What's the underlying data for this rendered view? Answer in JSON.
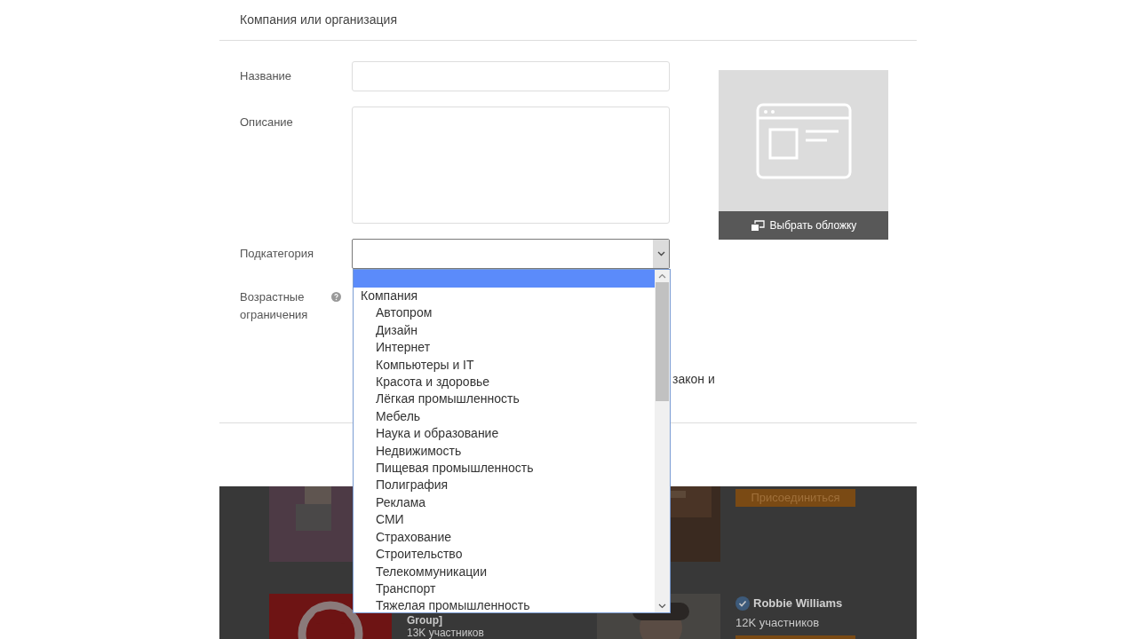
{
  "header": {
    "title": "Компания или организация"
  },
  "form": {
    "fields": [
      {
        "kind": "input",
        "label": "Название"
      },
      {
        "kind": "textarea",
        "label": "Описание"
      },
      {
        "kind": "select",
        "label": "Подкатегория",
        "expanded": true
      },
      {
        "kind": "info",
        "label": "Возрастные ограничения"
      }
    ],
    "partial_text": "закон и"
  },
  "cover": {
    "button": "Выбрать обложку"
  },
  "dropdown": {
    "empty_option_selected": true,
    "groups": [
      {
        "label": "Компания",
        "options": [
          {
            "label": "Автопром",
            "selected": false
          },
          {
            "label": "Дизайн",
            "selected": false
          },
          {
            "label": "Интернет",
            "selected": false
          },
          {
            "label": "Компьютеры и IT",
            "selected": false
          },
          {
            "label": "Красота и здоровье",
            "selected": false
          },
          {
            "label": "Лёгкая промышленность",
            "selected": false
          },
          {
            "label": "Мебель",
            "selected": false
          },
          {
            "label": "Наука и образование",
            "selected": false
          },
          {
            "label": "Недвижимость",
            "selected": false
          },
          {
            "label": "Пищевая промышленность",
            "selected": false
          },
          {
            "label": "Полиграфия",
            "selected": false
          },
          {
            "label": "Реклама",
            "selected": false
          },
          {
            "label": "СМИ",
            "selected": false
          },
          {
            "label": "Страхование",
            "selected": false
          },
          {
            "label": "Строительство",
            "selected": false
          },
          {
            "label": "Телекоммуникации",
            "selected": false
          },
          {
            "label": "Транспорт",
            "selected": false
          },
          {
            "label": "Тяжелая промышленность",
            "selected": false
          }
        ]
      }
    ]
  },
  "background_page": {
    "join_button": "Присоединиться",
    "groups": [
      {
        "name": "Group]",
        "members": "13K участников"
      },
      {
        "name": "Robbie Williams",
        "members": "12K участников"
      }
    ]
  }
}
